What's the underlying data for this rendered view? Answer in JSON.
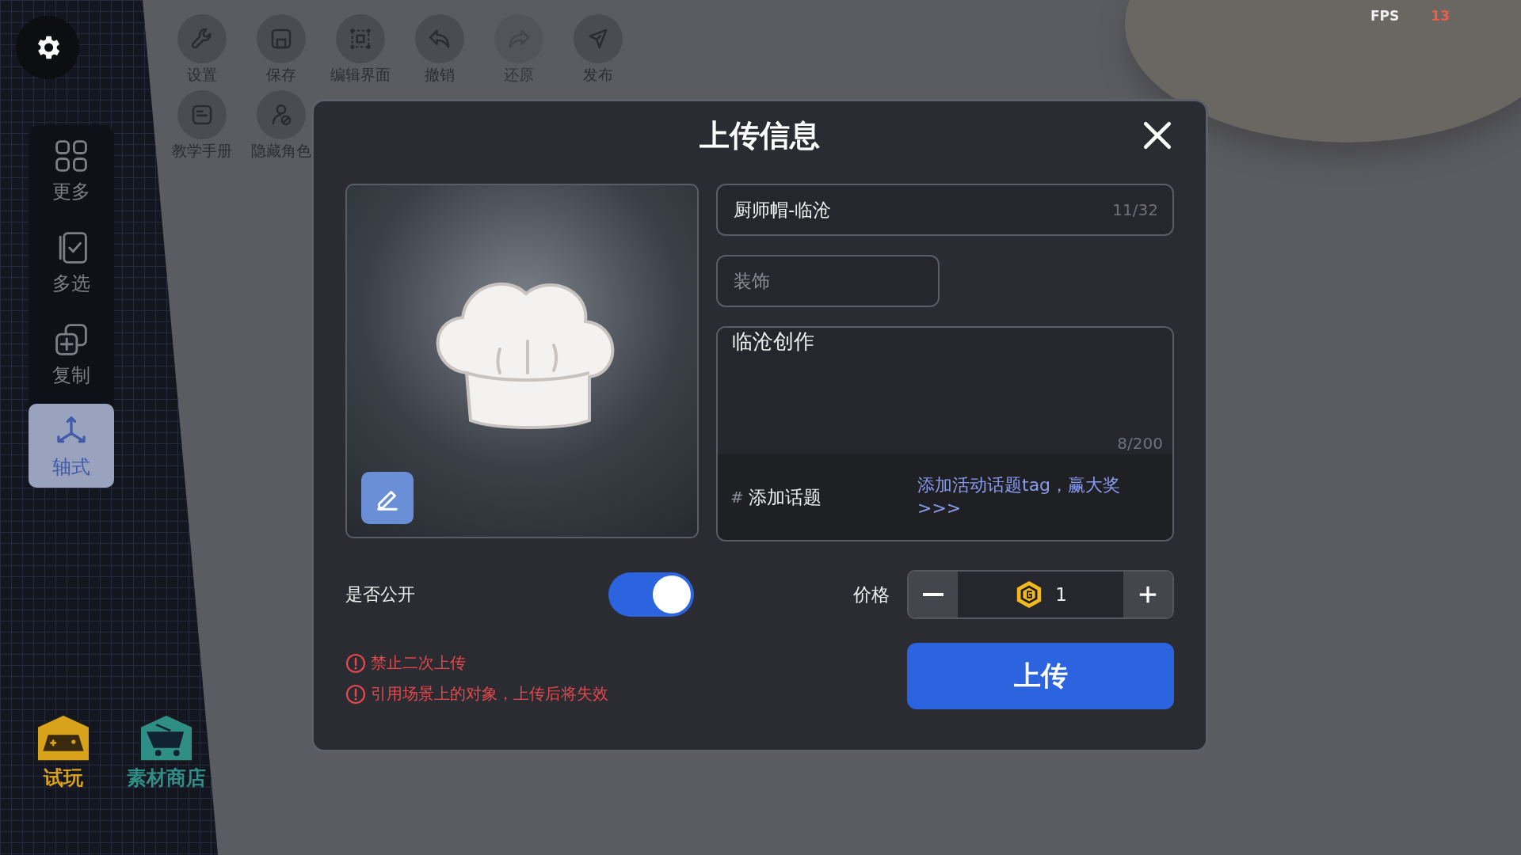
{
  "fps": {
    "label": "FPS",
    "value": "13"
  },
  "toolbar": [
    {
      "label": "设置",
      "disabled": false
    },
    {
      "label": "保存",
      "disabled": false
    },
    {
      "label": "编辑界面",
      "disabled": false
    },
    {
      "label": "撤销",
      "disabled": false
    },
    {
      "label": "还原",
      "disabled": true
    },
    {
      "label": "发布",
      "disabled": false
    }
  ],
  "toolbar_row2": [
    {
      "label": "教学手册",
      "disabled": false
    },
    {
      "label": "隐藏角色",
      "disabled": false
    }
  ],
  "sidebar": {
    "items": [
      {
        "label": "更多",
        "selected": false
      },
      {
        "label": "多选",
        "selected": false
      },
      {
        "label": "复制",
        "selected": false
      },
      {
        "label": "轴式",
        "selected": true
      }
    ]
  },
  "bottom_buttons": [
    {
      "label": "试玩",
      "color": "#d9a21b"
    },
    {
      "label": "素材商店",
      "color": "#2f8f86"
    }
  ],
  "dialog": {
    "title": "上传信息",
    "name_field": {
      "value": "厨师帽-临沧",
      "counter": "11/32"
    },
    "category_field": {
      "placeholder": "装饰"
    },
    "description_field": {
      "value": "临沧创作",
      "counter": "8/200"
    },
    "topic": {
      "hash": "#",
      "label": "添加话题",
      "promo": "添加活动话题tag，赢大奖 >>>"
    },
    "public": {
      "label": "是否公开",
      "on": true
    },
    "price": {
      "label": "价格",
      "value": "1"
    },
    "warnings": [
      "禁止二次上传",
      "引用场景上的对象，上传后将失效"
    ],
    "upload_button": "上传"
  }
}
